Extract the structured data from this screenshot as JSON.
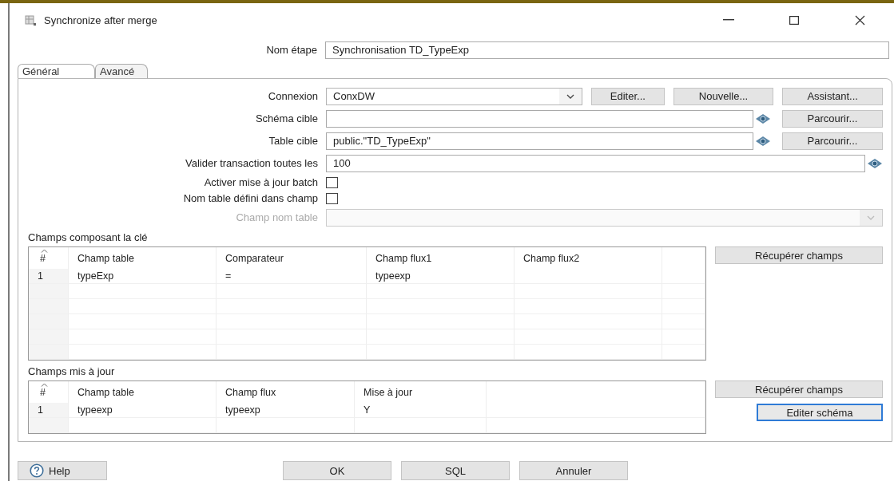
{
  "window": {
    "title": "Synchronize after merge"
  },
  "step_name": {
    "label": "Nom étape",
    "value": "Synchronisation TD_TypeExp"
  },
  "tabs": [
    {
      "label": "Général",
      "selected": true
    },
    {
      "label": "Avancé",
      "selected": false
    }
  ],
  "form": [
    {
      "kind": "select",
      "label": "Connexion",
      "value": "ConxDW",
      "disabled": false,
      "buttons": [
        "Editer...",
        "Nouvelle...",
        "Assistant..."
      ]
    },
    {
      "kind": "text",
      "label": "Schéma cible",
      "variable": true,
      "buttons": [
        "Parcourir..."
      ]
    },
    {
      "kind": "text",
      "label": "Table cible",
      "value": "public.\"TD_TypeExp\"",
      "variable": true,
      "buttons": [
        "Parcourir..."
      ]
    },
    {
      "kind": "text",
      "label": "Valider transaction toutes les",
      "value": "100",
      "variable": true
    },
    {
      "kind": "checkbox",
      "label": "Activer mise à jour batch",
      "checked": false
    },
    {
      "kind": "checkbox",
      "label": "Nom table défini dans champ",
      "checked": false
    },
    {
      "kind": "select",
      "label": "Champ nom table",
      "disabled": true
    }
  ],
  "key_fields": {
    "title": "Champs composant la clé",
    "columns": [
      "#",
      "Champ table",
      "Comparateur",
      "Champ flux1",
      "Champ flux2"
    ],
    "rows": [
      [
        "1",
        "typeExp",
        "=",
        "typeexp"
      ]
    ],
    "buttons": [
      {
        "label": "Récupérer champs",
        "focused": false
      }
    ]
  },
  "update_fields": {
    "title": "Champs mis à jour",
    "columns": [
      "#",
      "Champ table",
      "Champ flux",
      "Mise à jour"
    ],
    "rows": [
      [
        "1",
        "typeexp",
        "typeexp",
        "Y"
      ]
    ],
    "buttons": [
      {
        "label": "Récupérer champs",
        "focused": false
      },
      {
        "label": "Editer schéma",
        "focused": true
      }
    ]
  },
  "footer": {
    "help": "Help",
    "buttons": [
      "OK",
      "SQL",
      "Annuler"
    ]
  }
}
